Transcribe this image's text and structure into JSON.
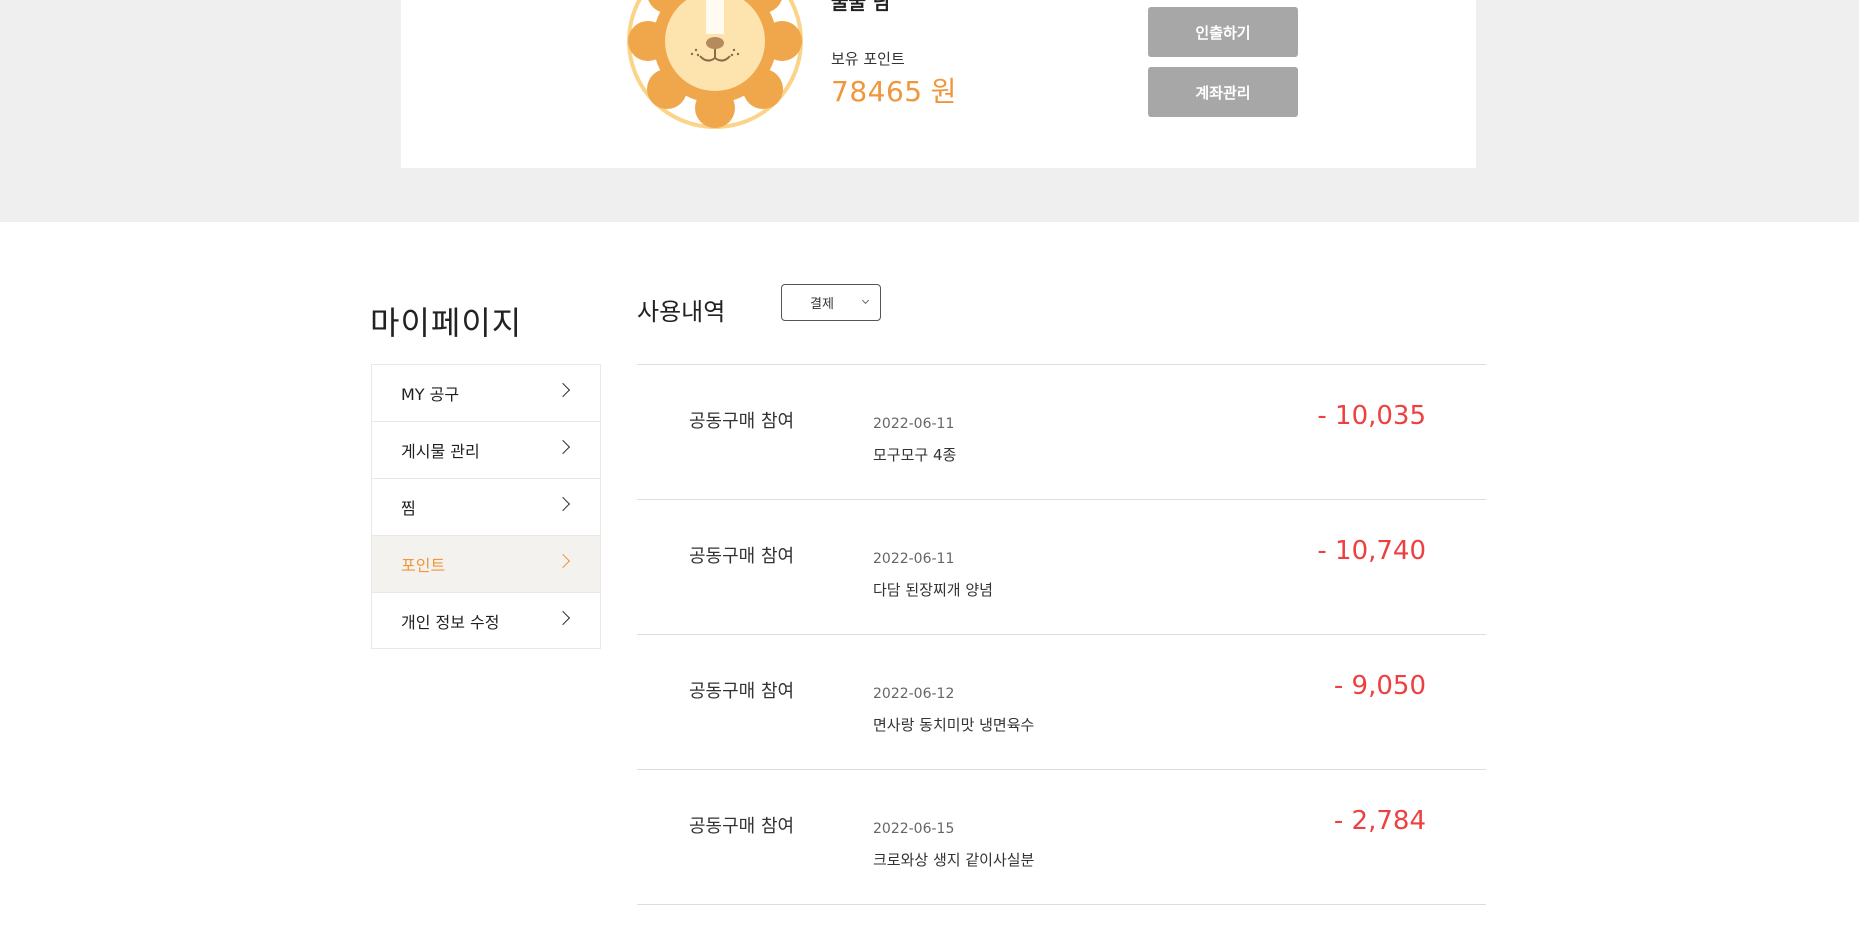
{
  "profile": {
    "username": "꿀꿀 님",
    "points_label": "보유 포인트",
    "points_value": "78465",
    "points_unit": "원",
    "withdraw_label": "인출하기",
    "account_label": "계좌관리"
  },
  "sidebar": {
    "title": "마이페이지",
    "items": [
      {
        "label": "MY 공구"
      },
      {
        "label": "게시물 관리"
      },
      {
        "label": "찜"
      },
      {
        "label": "포인트"
      },
      {
        "label": "개인 정보 수정"
      }
    ],
    "active_index": 3
  },
  "history": {
    "title": "사용내역",
    "filter_value": "결제",
    "rows": [
      {
        "type": "공동구매 참여",
        "date": "2022-06-11",
        "product": "모구모구 4종",
        "amount": "- 10,035"
      },
      {
        "type": "공동구매 참여",
        "date": "2022-06-11",
        "product": "다담 된장찌개 양념",
        "amount": "- 10,740"
      },
      {
        "type": "공동구매 참여",
        "date": "2022-06-12",
        "product": "면사랑 동치미맛 냉면육수",
        "amount": "- 9,050"
      },
      {
        "type": "공동구매 참여",
        "date": "2022-06-15",
        "product": "크로와상 생지 같이사실분",
        "amount": "- 2,784"
      }
    ]
  },
  "colors": {
    "accent_orange": "#f0963b",
    "negative_red": "#ee4040",
    "button_gray": "#a7a7a7",
    "band_gray": "#efefef"
  },
  "icons": [
    "lion-avatar-icon",
    "chevron-right-icon",
    "chevron-down-icon"
  ]
}
